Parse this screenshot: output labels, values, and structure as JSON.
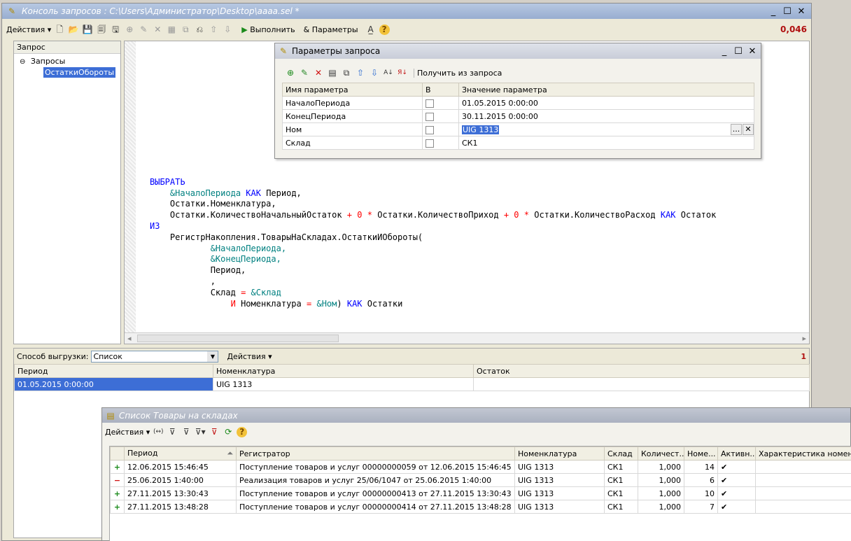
{
  "main_window": {
    "title": "Консоль запросов : C:\\Users\\Администратор\\Desktop\\аааа.sel *",
    "min": "_",
    "max": "☐",
    "close": "✕"
  },
  "toolbar": {
    "actions": "Действия",
    "execute": "Выполнить",
    "params": "Параметры",
    "timing": "0,046"
  },
  "tree": {
    "header": "Запрос",
    "root": "Запросы",
    "child": "ОстаткиОбороты"
  },
  "params_dialog": {
    "title": "Параметры запроса",
    "get_from_query": "Получить из запроса",
    "cols": [
      "Имя параметра",
      "В",
      "Значение параметра"
    ],
    "rows": [
      {
        "name": "НачалоПериода",
        "value": "01.05.2015 0:00:00"
      },
      {
        "name": "КонецПериода",
        "value": "30.11.2015 0:00:00"
      },
      {
        "name": "Ном",
        "value": "UIG 1313"
      },
      {
        "name": "Склад",
        "value": "СК1"
      }
    ],
    "ellipsis": "...",
    "clear": "✕"
  },
  "code": {
    "l1": "ВЫБРАТЬ",
    "l2_param": "&НачалоПериода",
    "l2_kw": "КАК",
    "l2_rest": " Период,",
    "l3": "Остатки.Номенклатура,",
    "l4_a": "Остатки.КоличествоНачальныйОстаток",
    "l4_plus": "+",
    "l4_zero": "0",
    "l4_mul": "*",
    "l4_b": "Остатки.КоличествоПриход",
    "l4_c": "Остатки.КоличествоРасход",
    "l4_kw": "КАК",
    "l4_d": "Остаток",
    "l5": "ИЗ",
    "l6": "РегистрНакопления.ТоварыНаСкладах.ОстаткиИОбороты(",
    "l7": "&НачалоПериода,",
    "l8": "&КонецПериода,",
    "l9": "Период,",
    "l10": ",",
    "l11_a": "Склад",
    "l11_eq": "=",
    "l11_p": "&Склад",
    "l12_and": "И",
    "l12_a": "Номенклатура",
    "l12_eq": "=",
    "l12_p": "&Ном",
    "l12_close": ")",
    "l12_kw": "КАК",
    "l12_b": "Остатки"
  },
  "result": {
    "export_label": "Способ выгрузки:",
    "export_value": "Список",
    "actions": "Действия",
    "count": "1",
    "cols": [
      "Период",
      "Номенклатура",
      "Остаток"
    ],
    "row": [
      "01.05.2015 0:00:00",
      "UIG 1313",
      ""
    ]
  },
  "list_window": {
    "title": "Список Товары на складах",
    "actions": "Действия",
    "cols": [
      "Период",
      "Регистратор",
      "Номенклатура",
      "Склад",
      "Количест...",
      "Номе...",
      "Активн...",
      "Характеристика номенкла"
    ],
    "rows": [
      {
        "sign": "+",
        "period": "12.06.2015 15:46:45",
        "reg": "Поступление товаров и услуг 00000000059 от 12.06.2015 15:46:45",
        "nom": "UIG 1313",
        "sklad": "СК1",
        "qty": "1,000",
        "num": "14",
        "act": "✔"
      },
      {
        "sign": "−",
        "period": "25.06.2015 1:40:00",
        "reg": "Реализация товаров и услуг 25/06/1047 от 25.06.2015 1:40:00",
        "nom": "UIG 1313",
        "sklad": "СК1",
        "qty": "1,000",
        "num": "6",
        "act": "✔"
      },
      {
        "sign": "+",
        "period": "27.11.2015 13:30:43",
        "reg": "Поступление товаров и услуг 00000000413 от 27.11.2015 13:30:43",
        "nom": "UIG 1313",
        "sklad": "СК1",
        "qty": "1,000",
        "num": "10",
        "act": "✔"
      },
      {
        "sign": "+",
        "period": "27.11.2015 13:48:28",
        "reg": "Поступление товаров и услуг 00000000414 от 27.11.2015 13:48:28",
        "nom": "UIG 1313",
        "sklad": "СК1",
        "qty": "1,000",
        "num": "7",
        "act": "✔"
      }
    ]
  },
  "colors": {
    "titlebar": "#a5b8d6",
    "selection": "#3d6ed6",
    "plus": "#1a8a1a",
    "minus": "#d01010",
    "code_keyword": "#0000ff",
    "code_param": "#008080",
    "code_op": "#ff0000"
  }
}
